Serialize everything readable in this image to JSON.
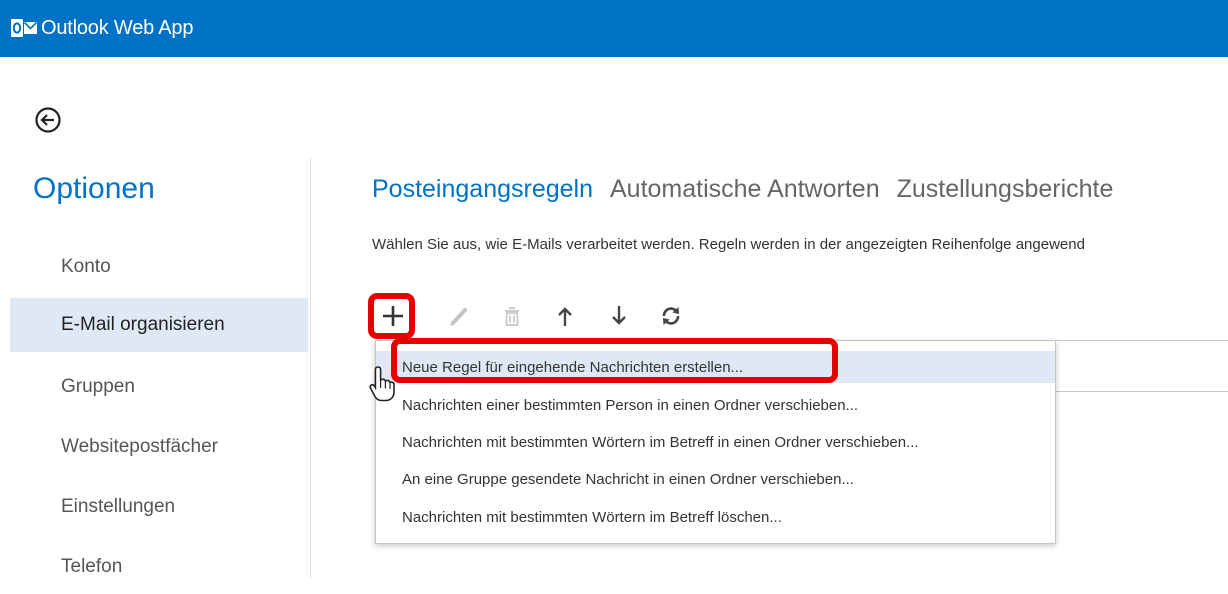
{
  "app": {
    "title": "Outlook Web App",
    "logo_icon": "outlook-logo-icon",
    "brand_color": "#0072c6"
  },
  "back_icon": "back-arrow-circle-icon",
  "sidebar": {
    "title": "Optionen",
    "items": [
      {
        "label": "Konto",
        "selected": false
      },
      {
        "label": "E-Mail organisieren",
        "selected": true
      },
      {
        "label": "Gruppen",
        "selected": false
      },
      {
        "label": "Websitepostfächer",
        "selected": false
      },
      {
        "label": "Einstellungen",
        "selected": false
      },
      {
        "label": "Telefon",
        "selected": false
      }
    ]
  },
  "tabs": [
    {
      "label": "Posteingangsregeln",
      "active": true
    },
    {
      "label": "Automatische Antworten",
      "active": false
    },
    {
      "label": "Zustellungsberichte",
      "active": false
    }
  ],
  "description": "Wählen Sie aus, wie E-Mails verarbeitet werden. Regeln werden in der angezeigten Reihenfolge angewend",
  "toolbar": {
    "buttons": [
      {
        "icon": "plus-icon",
        "enabled": true
      },
      {
        "icon": "pencil-icon",
        "enabled": false
      },
      {
        "icon": "trash-icon",
        "enabled": false
      },
      {
        "icon": "arrow-up-icon",
        "enabled": true
      },
      {
        "icon": "arrow-down-icon",
        "enabled": true
      },
      {
        "icon": "refresh-icon",
        "enabled": true
      }
    ]
  },
  "menu": {
    "items": [
      {
        "label": "Neue Regel für eingehende Nachrichten erstellen...",
        "highlighted": true
      },
      {
        "label": "Nachrichten einer bestimmten Person in einen Ordner verschieben...",
        "highlighted": false
      },
      {
        "label": "Nachrichten mit bestimmten Wörtern im Betreff in einen Ordner verschieben...",
        "highlighted": false
      },
      {
        "label": "An eine Gruppe gesendete Nachricht in einen Ordner verschieben...",
        "highlighted": false
      },
      {
        "label": "Nachrichten mit bestimmten Wörtern im Betreff löschen...",
        "highlighted": false
      }
    ]
  },
  "annotation_color": "#e60000"
}
